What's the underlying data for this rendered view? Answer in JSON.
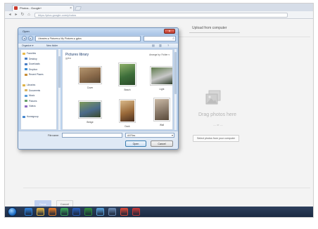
{
  "browser": {
    "tab_title": "Photos - Google+",
    "url": "https://plus.google.com/photos"
  },
  "page": {
    "upload_tab_label": "Upload from computer",
    "drag_text": "Drag photos here",
    "or_text": "— or —",
    "select_button_label": "Select photos from your computer",
    "confirm_label": "Done",
    "cancel_label": "Cancel"
  },
  "dialog": {
    "title": "Open",
    "path": "Libraries ▸ Pictures ▸ My Pictures ▸ gplus",
    "commands": {
      "organize": "Organize ▾",
      "new_folder": "New folder"
    },
    "nav_items": [
      {
        "label": "Favorites",
        "color": "#e8b94a"
      },
      {
        "label": "Desktop",
        "color": "#4d7fc4"
      },
      {
        "label": "Downloads",
        "color": "#4d7fc4"
      },
      {
        "label": "Dropbox",
        "color": "#3d8fd6"
      },
      {
        "label": "Recent Places",
        "color": "#c98f3a"
      },
      {
        "label": "",
        "color": ""
      },
      {
        "label": "Libraries",
        "color": "#e0b44a"
      },
      {
        "label": "Documents",
        "color": "#d9b562"
      },
      {
        "label": "Music",
        "color": "#5b9dd9"
      },
      {
        "label": "Pictures",
        "color": "#68a36b"
      },
      {
        "label": "Videos",
        "color": "#8e6cc2"
      },
      {
        "label": "",
        "color": ""
      },
      {
        "label": "Homegroup",
        "color": "#4a8ad0"
      }
    ],
    "library_title": "Pictures library",
    "library_subtitle": "gplus",
    "arrange_label": "Arrange by:  Folder ▾",
    "thumbnails": [
      {
        "label": "Cover",
        "colors": [
          "#8a6a4a",
          "#b59770",
          "#5d4a35"
        ]
      },
      {
        "label": "Beach",
        "colors": [
          "#3d6e3a",
          "#8fb06a",
          "#2a4a28"
        ]
      },
      {
        "label": "Light",
        "colors": [
          "#c8c8c8",
          "#5e7a4a",
          "#2f3f2a"
        ]
      },
      {
        "label": "Bridge",
        "colors": [
          "#4a6a8a",
          "#7e9a5a",
          "#3a4a2a"
        ]
      },
      {
        "label": "Dock",
        "colors": [
          "#9a6a3a",
          "#d9b98a",
          "#4a3020"
        ]
      },
      {
        "label": "Wall",
        "colors": [
          "#8a7a6a",
          "#cbbaa6",
          "#5a4a3a"
        ]
      }
    ],
    "filename_label": "File name:",
    "filetype_label": "All Files",
    "open_label": "Open",
    "cancel_label": "Cancel"
  },
  "taskbar": {
    "icons": [
      {
        "name": "ie-taskbar-icon",
        "color": "#2f7fd6"
      },
      {
        "name": "explorer-taskbar-icon",
        "color": "#e0b44a"
      },
      {
        "name": "media-player-taskbar-icon",
        "color": "#e07a2a"
      },
      {
        "name": "chrome-taskbar-icon",
        "color": "#3aa55a"
      },
      {
        "name": "word-taskbar-icon",
        "color": "#2b5fb8"
      },
      {
        "name": "excel-taskbar-icon",
        "color": "#2f8a3e"
      },
      {
        "name": "photos-taskbar-icon",
        "color": "#5aa0d8"
      },
      {
        "name": "network-taskbar-icon",
        "color": "#6a88b0"
      },
      {
        "name": "paint-taskbar-icon",
        "color": "#d84a3a"
      },
      {
        "name": "app-taskbar-icon",
        "color": "#c23a3a"
      }
    ]
  }
}
